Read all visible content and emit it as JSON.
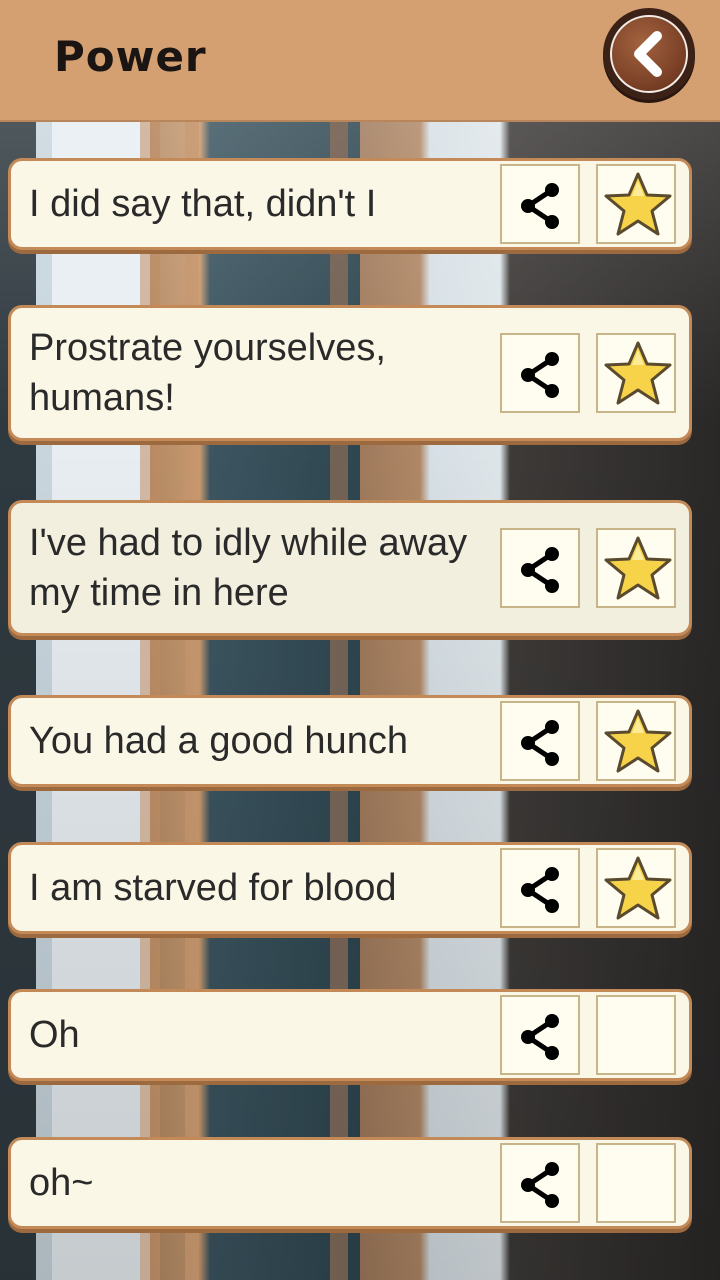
{
  "header": {
    "title": "Power",
    "back_icon": "back-arrow-icon"
  },
  "colors": {
    "header_bg": "#d4a072",
    "card_bg": "#fbf7e6",
    "card_border": "#c38a57",
    "star_fill": "#f7d34a",
    "text": "#2a2a2a"
  },
  "quotes": [
    {
      "text": "I did say that, didn't I",
      "favorited": true
    },
    {
      "text": "Prostrate yourselves, humans!",
      "favorited": true
    },
    {
      "text": "I've had to idly while away my time in here",
      "favorited": true
    },
    {
      "text": "You had a good hunch",
      "favorited": true
    },
    {
      "text": "I am starved for blood",
      "favorited": true
    },
    {
      "text": "Oh",
      "favorited": false
    },
    {
      "text": "oh~",
      "favorited": false
    }
  ]
}
